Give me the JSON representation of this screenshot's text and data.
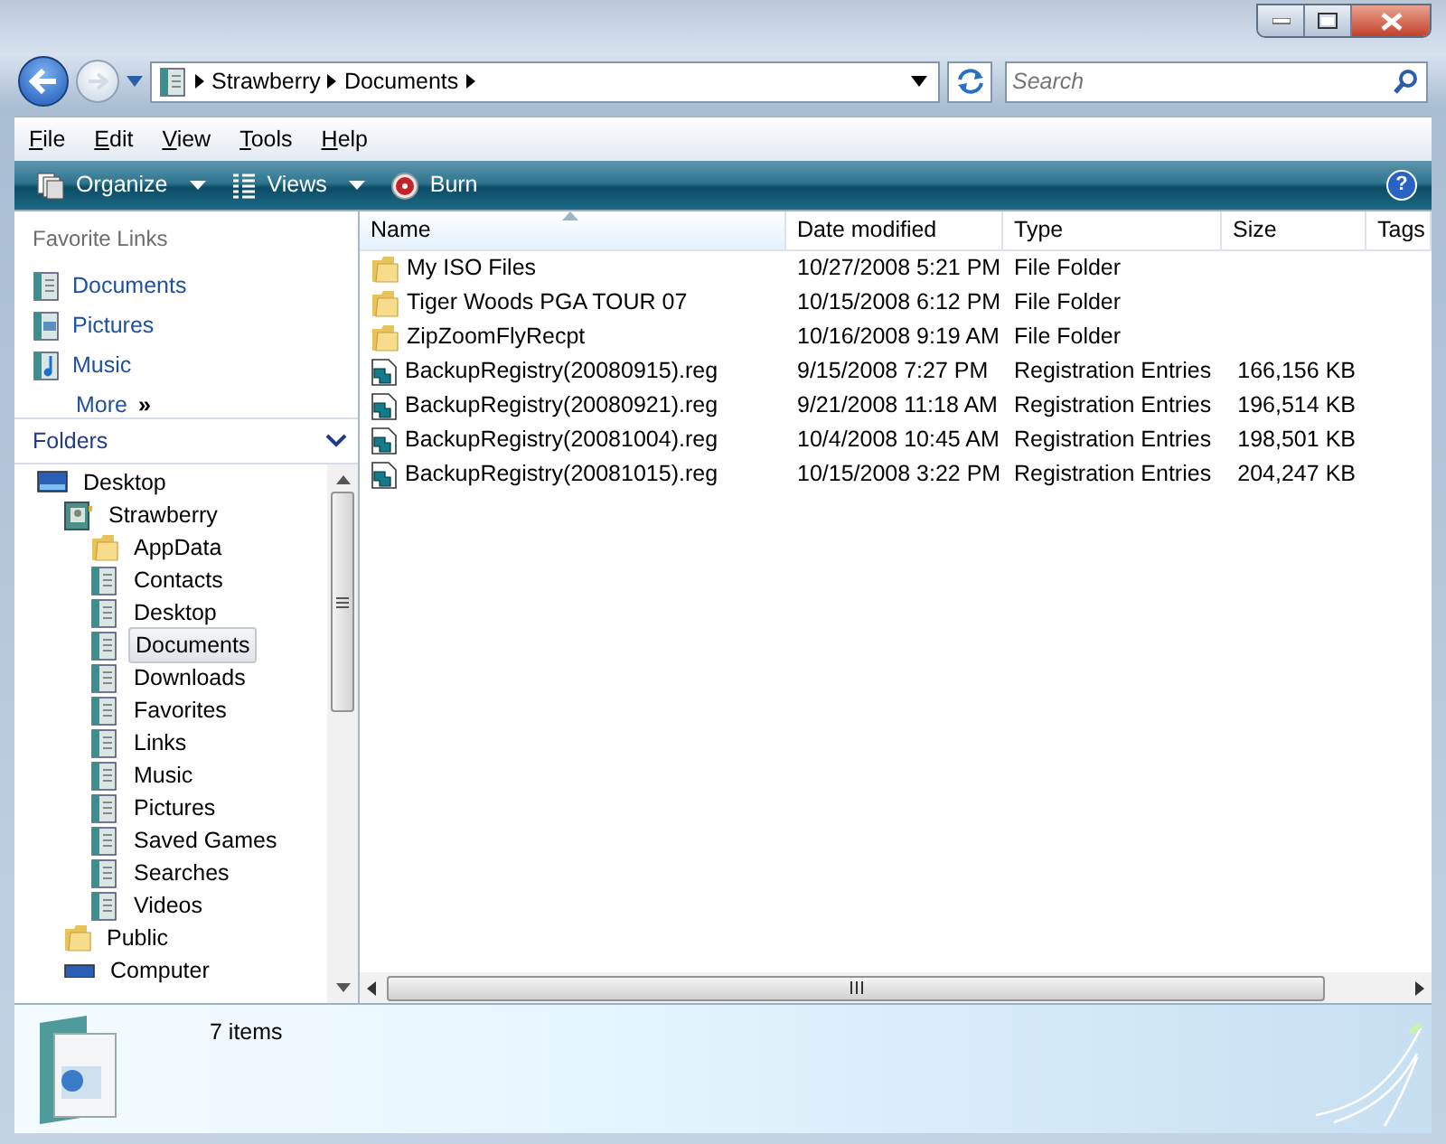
{
  "address": {
    "crumbs": [
      "Strawberry",
      "Documents"
    ]
  },
  "search": {
    "placeholder": "Search"
  },
  "menu": [
    "File",
    "Edit",
    "View",
    "Tools",
    "Help"
  ],
  "toolbar": [
    {
      "label": "Organize",
      "kind": "organize",
      "dropdown": true
    },
    {
      "label": "Views",
      "kind": "views",
      "dropdown": true
    },
    {
      "label": "Burn",
      "kind": "burn",
      "dropdown": false
    }
  ],
  "help_button": "?",
  "favorite_links": {
    "title": "Favorite Links",
    "items": [
      {
        "label": "Documents",
        "kind": "documents"
      },
      {
        "label": "Pictures",
        "kind": "pictures"
      },
      {
        "label": "Music",
        "kind": "music"
      },
      {
        "label": "More",
        "kind": "more",
        "suffix": "»"
      }
    ]
  },
  "folders": {
    "title": "Folders",
    "tree": [
      {
        "label": "Desktop",
        "kind": "desktop",
        "selected": false,
        "children": [
          {
            "label": "Strawberry",
            "kind": "user",
            "selected": false,
            "children": [
              {
                "label": "AppData",
                "kind": "folder",
                "selected": false
              },
              {
                "label": "Contacts",
                "kind": "library",
                "selected": false
              },
              {
                "label": "Desktop",
                "kind": "library",
                "selected": false
              },
              {
                "label": "Documents",
                "kind": "library",
                "selected": true
              },
              {
                "label": "Downloads",
                "kind": "library",
                "selected": false
              },
              {
                "label": "Favorites",
                "kind": "library",
                "selected": false
              },
              {
                "label": "Links",
                "kind": "library",
                "selected": false
              },
              {
                "label": "Music",
                "kind": "library",
                "selected": false
              },
              {
                "label": "Pictures",
                "kind": "library",
                "selected": false
              },
              {
                "label": "Saved Games",
                "kind": "library",
                "selected": false
              },
              {
                "label": "Searches",
                "kind": "library",
                "selected": false
              },
              {
                "label": "Videos",
                "kind": "library",
                "selected": false
              }
            ]
          },
          {
            "label": "Public",
            "kind": "folder",
            "selected": false
          },
          {
            "label": "Computer",
            "kind": "computer",
            "selected": false
          }
        ]
      }
    ]
  },
  "table": {
    "columns": [
      {
        "label": "Name",
        "sorted": true
      },
      {
        "label": "Date modified",
        "sorted": false
      },
      {
        "label": "Type",
        "sorted": false
      },
      {
        "label": "Size",
        "sorted": false
      },
      {
        "label": "Tags",
        "sorted": false
      }
    ],
    "rows": [
      {
        "kind": "folder",
        "cells": [
          "My ISO Files",
          "10/27/2008 5:21 PM",
          "File Folder",
          ""
        ]
      },
      {
        "kind": "folder",
        "cells": [
          "Tiger Woods PGA TOUR 07",
          "10/15/2008 6:12 PM",
          "File Folder",
          ""
        ]
      },
      {
        "kind": "folder",
        "cells": [
          "ZipZoomFlyRecpt",
          "10/16/2008 9:19 AM",
          "File Folder",
          ""
        ]
      },
      {
        "kind": "reg",
        "cells": [
          "BackupRegistry(20080915).reg",
          "9/15/2008 7:27 PM",
          "Registration Entries",
          "166,156 KB"
        ]
      },
      {
        "kind": "reg",
        "cells": [
          "BackupRegistry(20080921).reg",
          "9/21/2008 11:18 AM",
          "Registration Entries",
          "196,514 KB"
        ]
      },
      {
        "kind": "reg",
        "cells": [
          "BackupRegistry(20081004).reg",
          "10/4/2008 10:45 AM",
          "Registration Entries",
          "198,501 KB"
        ]
      },
      {
        "kind": "reg",
        "cells": [
          "BackupRegistry(20081015).reg",
          "10/15/2008 3:22 PM",
          "Registration Entries",
          "204,247 KB"
        ]
      }
    ]
  },
  "status_bar": {
    "text": "7 items"
  }
}
